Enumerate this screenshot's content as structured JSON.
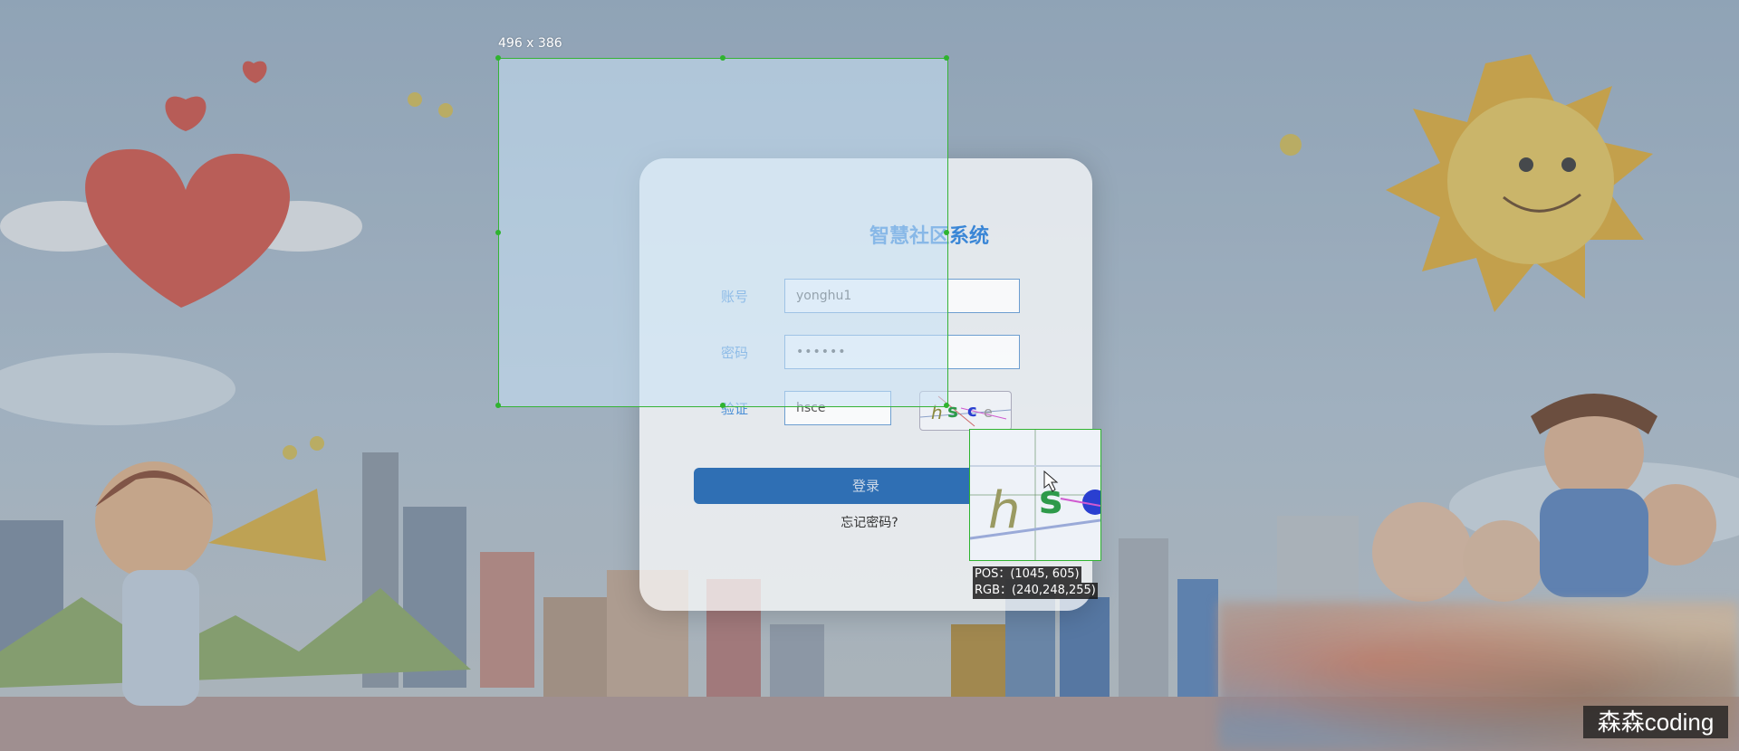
{
  "login": {
    "title": "智慧社区系统",
    "account_label": "账号",
    "account_value": "yonghu1",
    "password_label": "密码",
    "password_value": "••••••",
    "verify_label": "验证",
    "verify_value": "hsce",
    "captcha_text": "hsce",
    "login_button": "登录",
    "forgot_link": "忘记密码?"
  },
  "screenshot_tool": {
    "selection_size": "496 x 386",
    "magnifier_pos": "POS：(1045, 605)",
    "magnifier_rgb": "RGB：(240,248,255)"
  },
  "watermark": "森森coding",
  "colors": {
    "accent": "#3a86d6",
    "button": "#2f6fb4",
    "selection_border": "#36b336"
  }
}
